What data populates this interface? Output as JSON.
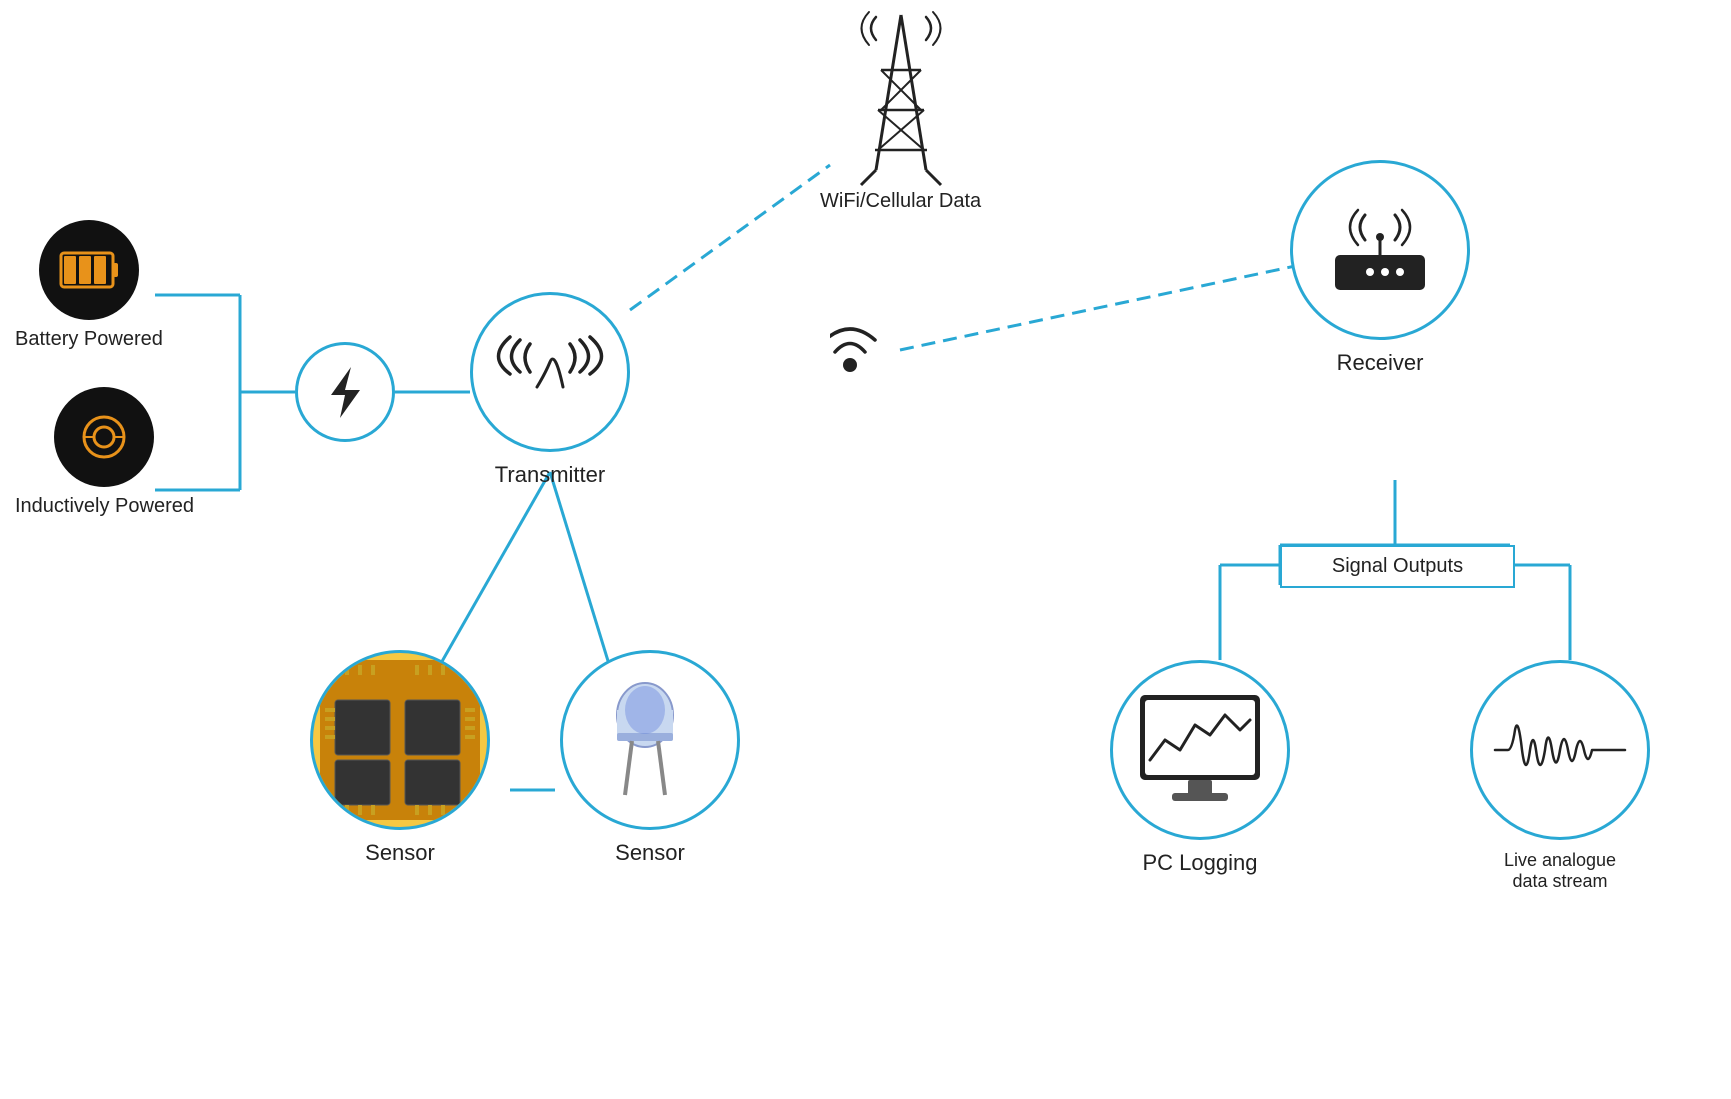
{
  "nodes": {
    "battery_label": "Battery Powered",
    "inductive_label": "Inductively Powered",
    "transmitter_label": "Transmitter",
    "sensor1_label": "Sensor",
    "sensor2_label": "Sensor",
    "receiver_label": "Receiver",
    "pc_logging_label": "PC Logging",
    "analogue_label": "Live analogue\ndata stream",
    "signal_outputs_label": "Signal Outputs",
    "wifi_label": "WiFi/Cellular Data"
  },
  "colors": {
    "blue": "#29a8d4",
    "dark": "#111",
    "orange": "#e8921a",
    "text": "#222"
  }
}
